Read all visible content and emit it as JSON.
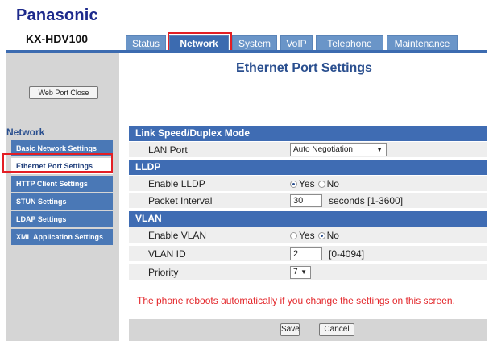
{
  "brand": "Panasonic",
  "model": "KX-HDV100",
  "tabs": [
    {
      "label": "Status",
      "active": false
    },
    {
      "label": "Network",
      "active": true
    },
    {
      "label": "System",
      "active": false
    },
    {
      "label": "VoIP",
      "active": false
    },
    {
      "label": "Telephone",
      "active": false
    },
    {
      "label": "Maintenance",
      "active": false
    }
  ],
  "sidebar": {
    "web_port_close": "Web Port Close",
    "title": "Network",
    "items": [
      {
        "label": "Basic Network Settings",
        "selected": false
      },
      {
        "label": "Ethernet Port Settings",
        "selected": true
      },
      {
        "label": "HTTP Client Settings",
        "selected": false
      },
      {
        "label": "STUN Settings",
        "selected": false
      },
      {
        "label": "LDAP Settings",
        "selected": false
      },
      {
        "label": "XML Application Settings",
        "selected": false
      }
    ]
  },
  "page_title": "Ethernet Port Settings",
  "sections": {
    "link": {
      "title": "Link Speed/Duplex Mode",
      "lan_port_label": "LAN Port",
      "lan_port_value": "Auto Negotiation"
    },
    "lldp": {
      "title": "LLDP",
      "enable_label": "Enable LLDP",
      "yes": "Yes",
      "no": "No",
      "enabled": "yes",
      "interval_label": "Packet Interval",
      "interval_value": "30",
      "interval_hint": "seconds [1-3600]"
    },
    "vlan": {
      "title": "VLAN",
      "enable_label": "Enable VLAN",
      "yes": "Yes",
      "no": "No",
      "enabled": "no",
      "id_label": "VLAN ID",
      "id_value": "2",
      "id_hint": "[0-4094]",
      "priority_label": "Priority",
      "priority_value": "7"
    }
  },
  "notice": "The phone reboots automatically if you change the settings on this screen.",
  "buttons": {
    "save": "Save",
    "cancel": "Cancel"
  }
}
